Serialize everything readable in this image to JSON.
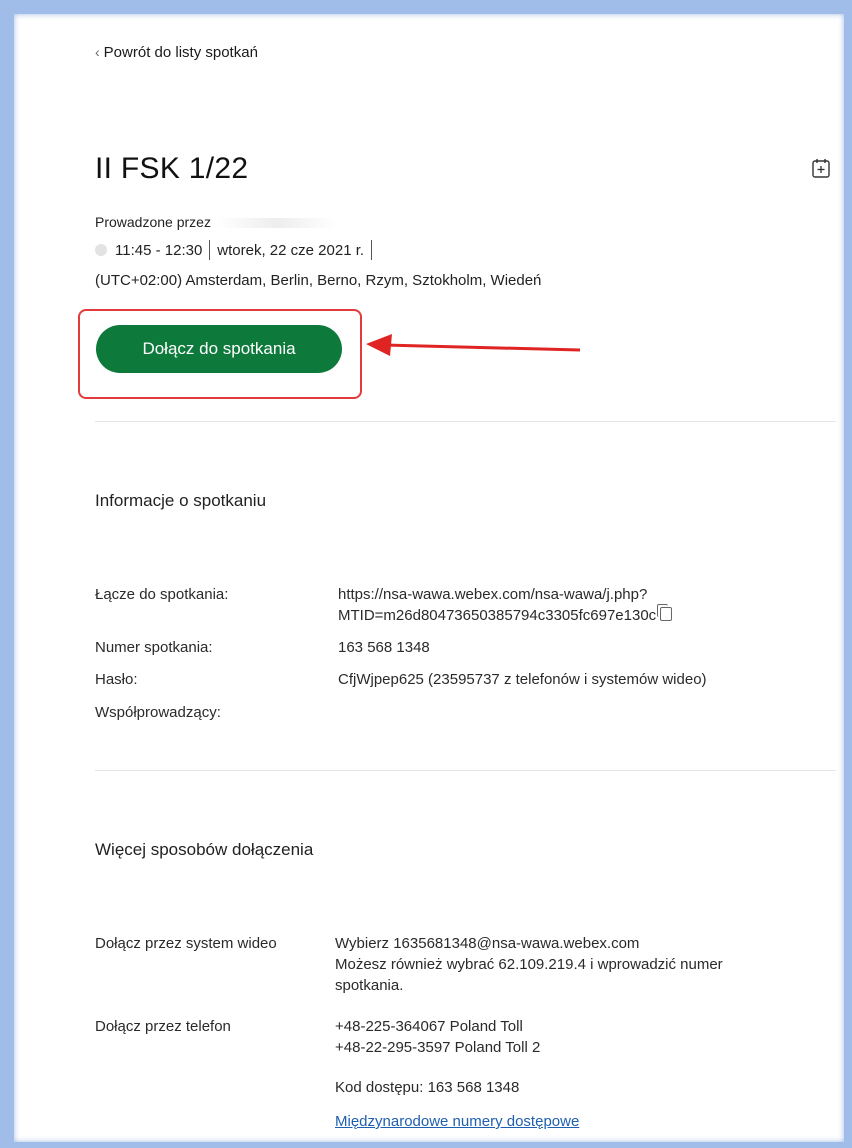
{
  "nav": {
    "back_label": "Powrót do listy spotkań"
  },
  "meeting": {
    "title": "II FSK 1/22",
    "host_prefix": "Prowadzone przez",
    "time": "11:45 - 12:30",
    "date": "wtorek, 22 cze 2021 r.",
    "timezone": "(UTC+02:00) Amsterdam, Berlin, Berno, Rzym, Sztokholm, Wiedeń",
    "join_label": "Dołącz do spotkania"
  },
  "info": {
    "heading": "Informacje o spotkaniu",
    "link_label": "Łącze do spotkania:",
    "link_line1": "https://nsa-wawa.webex.com/nsa-wawa/j.php?",
    "link_line2": "MTID=m26d80473650385794c3305fc697e130c",
    "number_label": "Numer spotkania:",
    "number_value": "163 568 1348",
    "password_label": "Hasło:",
    "password_value": "CfjWjpep625 (23595737 z telefonów i systemów wideo)",
    "cohost_label": "Współprowadzący:"
  },
  "more": {
    "heading": "Więcej sposobów dołączenia",
    "video_label": "Dołącz przez system wideo",
    "video_line1": "Wybierz 1635681348@nsa-wawa.webex.com",
    "video_line2": "Możesz również wybrać 62.109.219.4 i wprowadzić numer",
    "video_line3": "spotkania.",
    "phone_label": "Dołącz przez telefon",
    "phone_line1": "+48-225-364067 Poland Toll",
    "phone_line2": "+48-22-295-3597 Poland Toll 2",
    "access_code": "Kod dostępu: 163 568 1348",
    "intl_link": "Międzynarodowe numery dostępowe"
  },
  "colors": {
    "join_button": "#0d7a3c",
    "highlight": "#e23b3b",
    "link": "#1f5fb0",
    "frame": "#9fbde8"
  }
}
